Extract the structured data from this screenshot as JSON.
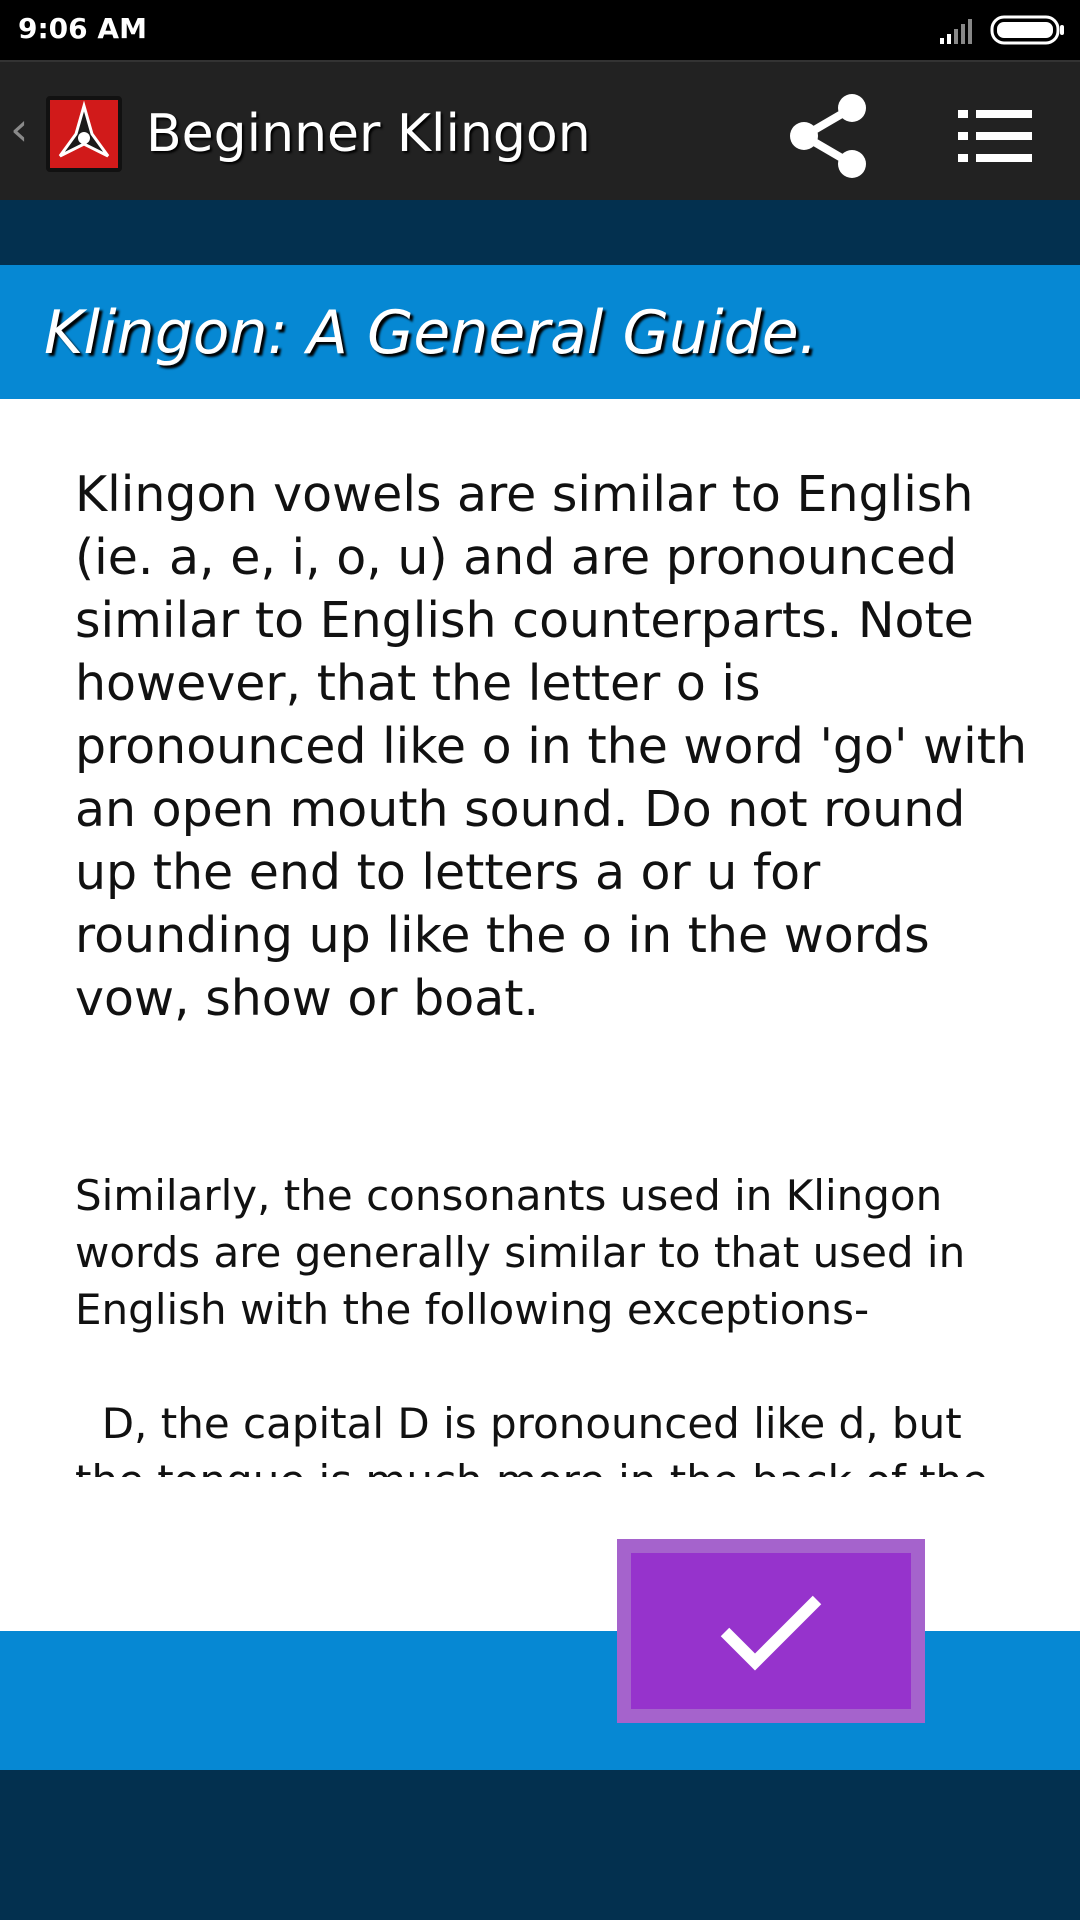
{
  "status_bar": {
    "time": "9:06 AM",
    "signal_icon": "signal-icon",
    "battery_icon": "battery-icon"
  },
  "action_bar": {
    "back_icon": "chevron-left-icon",
    "app_logo_icon": "klingon-emblem-icon",
    "title": "Beginner Klingon",
    "share_icon": "share-icon",
    "menu_icon": "list-menu-icon"
  },
  "section": {
    "title": "Klingon: A General Guide."
  },
  "content": {
    "paragraph_1": "Klingon vowels are similar to English (ie. a, e, i, o, u) and are pronounced similar to English counterparts. Note however, that the letter o is pronounced like o in the word 'go' with an open mouth sound. Do not round up the end to letters a or u for rounding up like the o in the words vow, show or boat.",
    "paragraph_2": "Similarly, the consonants used in Klingon words are generally similar to that used in English with the following exceptions-",
    "paragraph_3": "  D, the capital D is pronounced like d, but the tongue is much more in the back of the"
  },
  "confirm_button": {
    "icon": "checkmark-icon"
  },
  "colors": {
    "accent_blue": "#0688d3",
    "dark_navy": "#03304f",
    "button_purple": "#9633cc",
    "action_bar": "#222222"
  }
}
